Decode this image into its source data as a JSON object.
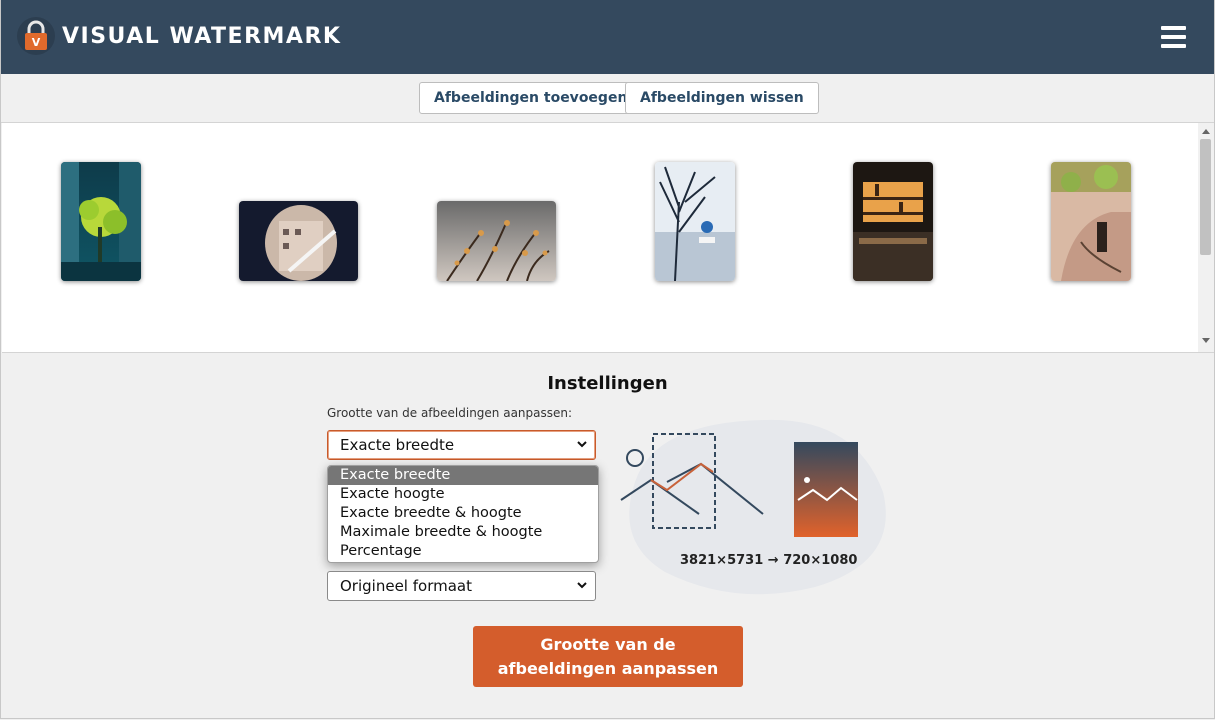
{
  "header": {
    "brand": "VISUAL WATERMARK",
    "logo_icon": "padlock-logo-icon",
    "menu_icon": "hamburger-menu-icon"
  },
  "toolbar": {
    "add_images": "Afbeeldingen toevoegen",
    "clear_images": "Afbeeldingen wissen"
  },
  "gallery": {
    "thumbnails": [
      {
        "subject": "green tree between tall buildings"
      },
      {
        "subject": "building seen through round window"
      },
      {
        "subject": "blossoming branches against grey sky"
      },
      {
        "subject": "bare tree branches with blue sign"
      },
      {
        "subject": "shelves of an indoor bar"
      },
      {
        "subject": "old house covered with plants"
      }
    ]
  },
  "settings": {
    "title": "Instellingen",
    "resize_label": "Grootte van de afbeeldingen aanpassen:",
    "resize_select_value": "Exacte breedte",
    "resize_options": [
      "Exacte breedte",
      "Exacte hoogte",
      "Exacte breedte & hoogte",
      "Maximale breedte & hoogte",
      "Percentage"
    ],
    "format_select_value": "Origineel formaat",
    "dimensions_text": "3821×5731 → 720×1080",
    "submit_label": "Grootte van de afbeeldingen aanpassen"
  },
  "colors": {
    "header_bg": "#34495e",
    "accent": "#d45d2c",
    "button_text": "#2a4a66"
  }
}
